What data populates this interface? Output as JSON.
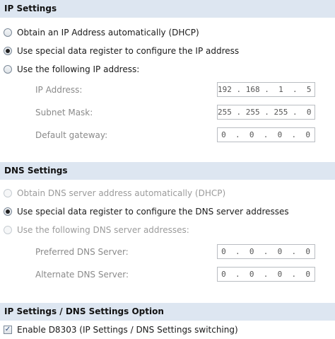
{
  "ip_settings": {
    "header": "IP Settings",
    "options": [
      {
        "label": "Obtain an IP Address automatically (DHCP)",
        "checked": false,
        "disabled": false
      },
      {
        "label": "Use special data register to configure the IP address",
        "checked": true,
        "disabled": false
      },
      {
        "label": "Use the following IP address:",
        "checked": false,
        "disabled": false
      }
    ],
    "fields": [
      {
        "label": "IP Address:",
        "value": "192 . 168 .  1  .  5"
      },
      {
        "label": "Subnet Mask:",
        "value": "255 . 255 . 255 .  0"
      },
      {
        "label": "Default gateway:",
        "value": "0  .  0  .  0  .  0"
      }
    ]
  },
  "dns_settings": {
    "header": "DNS Settings",
    "options": [
      {
        "label": "Obtain DNS server address automatically (DHCP)",
        "checked": false,
        "disabled": true
      },
      {
        "label": "Use special data register to configure the DNS server addresses",
        "checked": true,
        "disabled": false
      },
      {
        "label": "Use the following DNS server addresses:",
        "checked": false,
        "disabled": true
      }
    ],
    "fields": [
      {
        "label": "Preferred DNS Server:",
        "value": "0  .  0  .  0  .  0"
      },
      {
        "label": "Alternate DNS Server:",
        "value": "0  .  0  .  0  .  0"
      }
    ]
  },
  "option_settings": {
    "header": "IP Settings / DNS Settings Option",
    "checkbox_label": "Enable D8303 (IP Settings / DNS Settings switching)",
    "checkbox_checked": true,
    "check_glyph": "✓"
  }
}
